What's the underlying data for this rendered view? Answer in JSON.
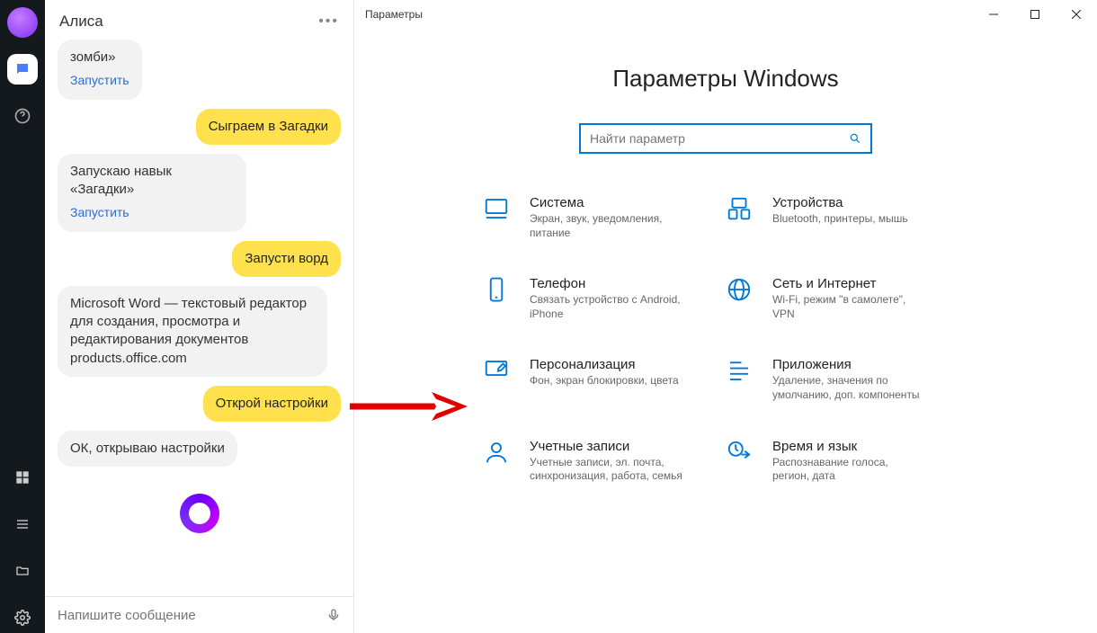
{
  "rail": {
    "items": [
      "alisa-orb",
      "chat",
      "help",
      "spacer",
      "start",
      "list",
      "folder",
      "settings-gear"
    ]
  },
  "chat": {
    "title": "Алиса",
    "messages": [
      {
        "kind": "bot-narrow",
        "text": "зомби»",
        "action": "Запустить"
      },
      {
        "kind": "user",
        "text": "Сыграем в Загадки"
      },
      {
        "kind": "bot-narrow",
        "text": "Запускаю навык «Загадки»",
        "action": "Запустить"
      },
      {
        "kind": "user",
        "text": "Запусти ворд"
      },
      {
        "kind": "bot",
        "text": "Microsoft Word — текстовый редактор для создания, просмотра и редактирования документов products.office.com"
      },
      {
        "kind": "user",
        "text": "Открой настройки"
      },
      {
        "kind": "bot",
        "text": "ОК, открываю настройки"
      }
    ],
    "input_placeholder": "Напишите сообщение"
  },
  "settings": {
    "window_title": "Параметры",
    "heading": "Параметры Windows",
    "search_placeholder": "Найти параметр",
    "tiles": [
      {
        "title": "Система",
        "sub": "Экран, звук, уведомления, питание",
        "icon": "monitor"
      },
      {
        "title": "Устройства",
        "sub": "Bluetooth, принтеры, мышь",
        "icon": "devices"
      },
      {
        "title": "Телефон",
        "sub": "Связать устройство с Android, iPhone",
        "icon": "phone"
      },
      {
        "title": "Сеть и Интернет",
        "sub": "Wi-Fi, режим \"в самолете\", VPN",
        "icon": "globe"
      },
      {
        "title": "Персонализация",
        "sub": "Фон, экран блокировки, цвета",
        "icon": "personalize"
      },
      {
        "title": "Приложения",
        "sub": "Удаление, значения по умолчанию, доп. компоненты",
        "icon": "apps"
      },
      {
        "title": "Учетные записи",
        "sub": "Учетные записи, эл. почта, синхронизация, работа, семья",
        "icon": "account"
      },
      {
        "title": "Время и язык",
        "sub": "Распознавание голоса, регион, дата",
        "icon": "time-lang"
      }
    ]
  }
}
